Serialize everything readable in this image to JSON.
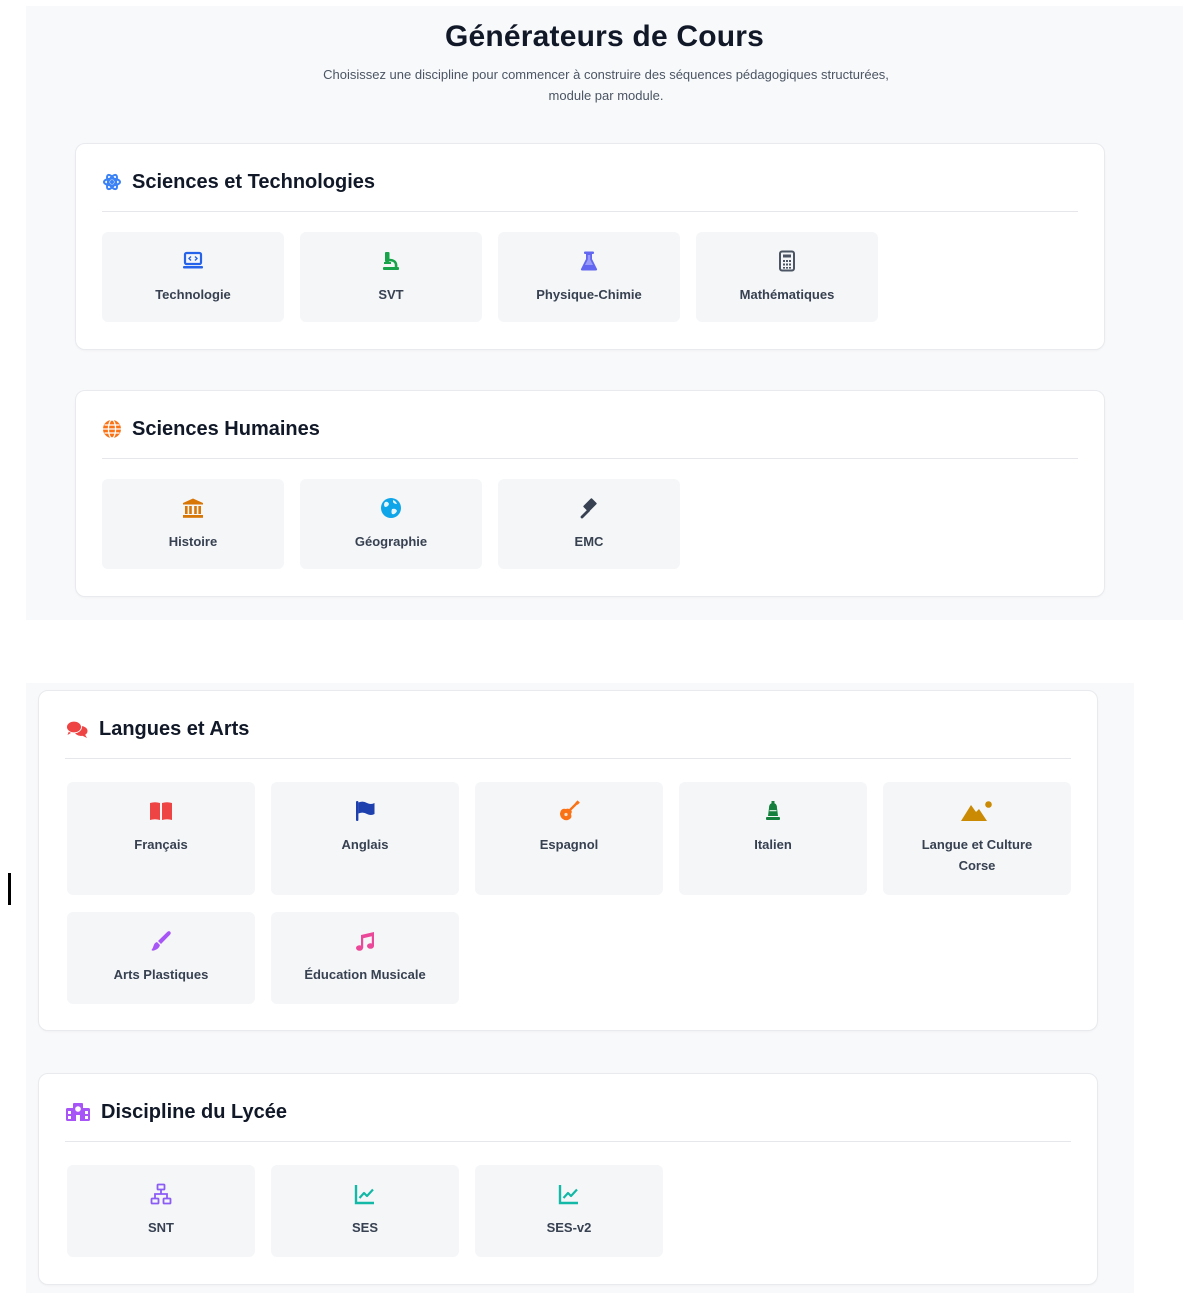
{
  "header": {
    "title": "Générateurs de Cours",
    "subtitle": "Choisissez une discipline pour commencer à construire des séquences pédagogiques structurées, module par module."
  },
  "sections": [
    {
      "title": "Sciences et Technologies",
      "icon": "atom-icon",
      "color": "#3b82f6",
      "items": [
        {
          "label": "Technologie",
          "icon": "laptop-code-icon",
          "color": "#2563eb"
        },
        {
          "label": "SVT",
          "icon": "microscope-icon",
          "color": "#16a34a"
        },
        {
          "label": "Physique-Chimie",
          "icon": "flask-icon",
          "color": "#6366f1"
        },
        {
          "label": "Mathématiques",
          "icon": "calculator-icon",
          "color": "#4b5563"
        }
      ]
    },
    {
      "title": "Sciences Humaines",
      "icon": "globe-icon",
      "color": "#f97316",
      "items": [
        {
          "label": "Histoire",
          "icon": "landmark-icon",
          "color": "#d97706"
        },
        {
          "label": "Géographie",
          "icon": "earth-icon",
          "color": "#0ea5e9"
        },
        {
          "label": "EMC",
          "icon": "gavel-icon",
          "color": "#374151"
        }
      ]
    },
    {
      "title": "Langues et Arts",
      "icon": "comments-icon",
      "color": "#ef4444",
      "items": [
        {
          "label": "Français",
          "icon": "book-icon",
          "color": "#ef4444"
        },
        {
          "label": "Anglais",
          "icon": "flag-icon",
          "color": "#1e40af"
        },
        {
          "label": "Espagnol",
          "icon": "guitar-icon",
          "color": "#f97316"
        },
        {
          "label": "Italien",
          "icon": "bell-icon",
          "color": "#15803d"
        },
        {
          "label": "Langue et Culture Corse",
          "icon": "mountain-icon",
          "color": "#ca8a04"
        },
        {
          "label": "Arts Plastiques",
          "icon": "paintbrush-icon",
          "color": "#a855f7"
        },
        {
          "label": "Éducation Musicale",
          "icon": "music-icon",
          "color": "#ec4899"
        }
      ]
    },
    {
      "title": "Discipline du Lycée",
      "icon": "school-icon",
      "color": "#a855f7",
      "items": [
        {
          "label": "SNT",
          "icon": "network-icon",
          "color": "#8b5cf6"
        },
        {
          "label": "SES",
          "icon": "chart-line-icon",
          "color": "#14b8a6"
        },
        {
          "label": "SES-v2",
          "icon": "chart-line-icon",
          "color": "#14b8a6"
        }
      ]
    }
  ]
}
